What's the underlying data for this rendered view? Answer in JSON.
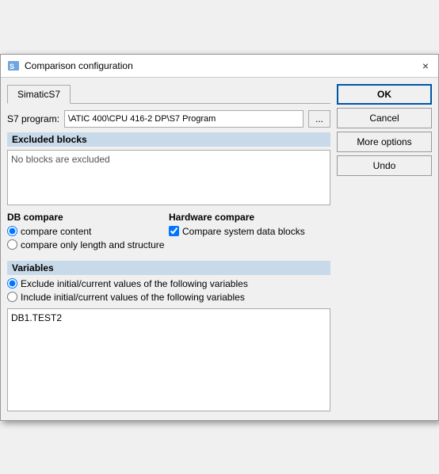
{
  "titleBar": {
    "title": "Comparison configuration",
    "closeLabel": "×"
  },
  "tabs": [
    {
      "label": "SimaticS7",
      "active": true
    }
  ],
  "s7Program": {
    "label": "S7 program:",
    "value": "\\ATIC 400\\CPU 416-2 DP\\S7 Program",
    "btnLabel": "..."
  },
  "excludedBlocks": {
    "header": "Excluded blocks",
    "placeholder": "No blocks are excluded"
  },
  "dbCompare": {
    "label": "DB compare",
    "options": [
      {
        "label": "compare content",
        "checked": true
      },
      {
        "label": "compare only length and structure",
        "checked": false
      }
    ]
  },
  "hardwareCompare": {
    "label": "Hardware compare",
    "checkbox": {
      "label": "Compare system data blocks",
      "checked": true
    }
  },
  "variables": {
    "header": "Variables",
    "options": [
      {
        "label": "Exclude initial/current values of the following variables",
        "checked": true
      },
      {
        "label": "Include initial/current values of the following variables",
        "checked": false
      }
    ],
    "textareaValue": "DB1.TEST2"
  },
  "buttons": {
    "ok": "OK",
    "cancel": "Cancel",
    "moreOptions": "More options",
    "undo": "Undo"
  }
}
